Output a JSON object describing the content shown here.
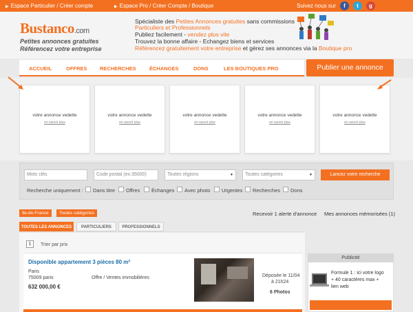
{
  "topbar": {
    "link1": "Espace Particulier / Créer compte",
    "link2": "Espace Pro / Créer Compte / Boutique",
    "follow": "Suivez nous sur"
  },
  "header": {
    "logo_main": "Bustanco",
    "logo_ext": ".com",
    "tagline1": "Petites annonces gratuites",
    "tagline2": "Référencez votre entreprise",
    "spec_line1_a": "Spécialiste des ",
    "spec_line1_b": "Petites Annonces gratuites",
    "spec_line1_c": " sans commissions",
    "spec_line2": "Particuliers et Professionnels",
    "spec_line3_a": "Publiez facilement - ",
    "spec_line3_b": "vendez plus vite",
    "spec_line4": "Trouvez la bonne affaire - Echangez biens et services",
    "spec_line5_a": "Référencez gratuitement votre entreprise",
    "spec_line5_b": " et gérez ses annonces via la ",
    "spec_line5_c": "Boutique pro"
  },
  "nav": {
    "items": [
      "ACCUEIL",
      "OFFRES",
      "RECHERCHES",
      "ÉCHANGES",
      "DONS",
      "LES BOUTIQUES PRO"
    ],
    "publish": "Publier une annonce"
  },
  "featured": {
    "title": "votre annonce vedette",
    "more": "en savoir plus"
  },
  "search": {
    "keywords_placeholder": "Mots clés",
    "postal_placeholder": "Code postal (ex:35000)",
    "regions": "Toutes régions",
    "categories": "Toutes catégories",
    "button": "Lancez votre recherche",
    "filter_label": "Recherche uniquement :",
    "filters": [
      "Dans titre",
      "Offres",
      "Échanges",
      "Avec photo",
      "Urgentes",
      "Recherches",
      "Dons"
    ]
  },
  "breadcrumb": {
    "region": "Ile-de-France",
    "category": "Toutes catégories"
  },
  "alerts": {
    "receive": "Recevoir 1 alerte d'annonce",
    "saved": "Mes annonces mémorisées (1)"
  },
  "tabs": [
    "TOUTES LES ANNONCES",
    "PARTICULIERS",
    "PROFESSIONNELS"
  ],
  "listing": {
    "page": "1",
    "sort": "Trier par prix",
    "title": "Disponible appartement 3 pièces 80 m²",
    "city": "Paris",
    "postal": "75009 paris",
    "type": "Offre / Ventes immobilières",
    "price": "632 000,00 €",
    "posted": "Déposée le 11/04",
    "time": "à 21h24",
    "photos": "6 Photos"
  },
  "publicite": {
    "title": "Publicité",
    "line1": "Formule 1 : ici votre logo",
    "line2": "+ 40 caractères max +",
    "line3": "lien web"
  },
  "colors": {
    "accent": "#f37021",
    "link": "#1a6ea8"
  },
  "icons": [
    "facebook-icon",
    "twitter-icon",
    "google-plus-icon",
    "arrow-icon"
  ]
}
